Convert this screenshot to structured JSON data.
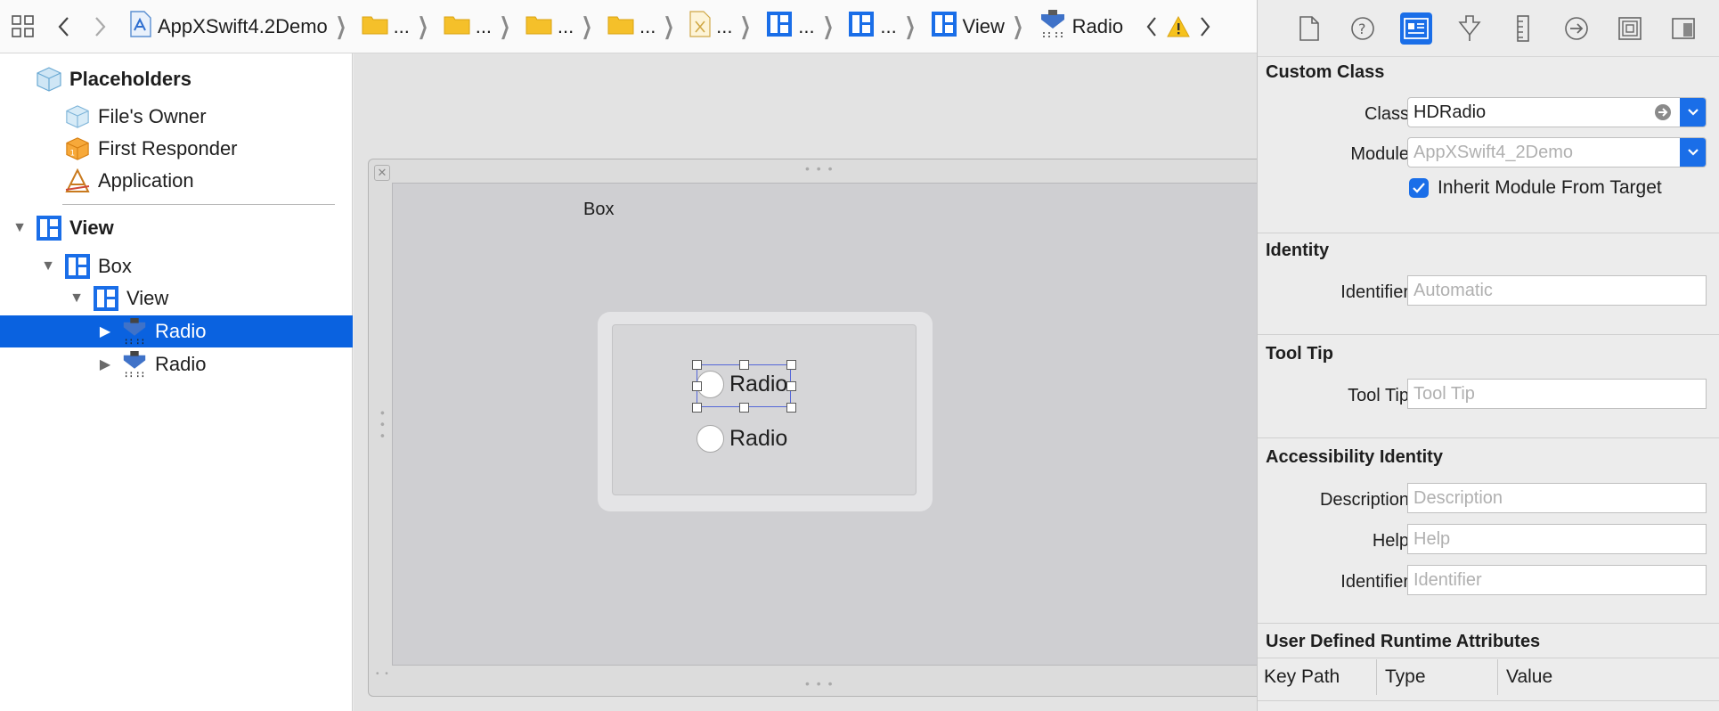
{
  "jumpbar": {
    "crumbs": [
      {
        "label": "AppXSwift4.2Demo",
        "icon": "swift-project-icon"
      },
      {
        "label": "...",
        "icon": "folder-icon"
      },
      {
        "label": "...",
        "icon": "folder-icon"
      },
      {
        "label": "...",
        "icon": "folder-icon"
      },
      {
        "label": "...",
        "icon": "folder-icon"
      },
      {
        "label": "...",
        "icon": "xib-file-icon"
      },
      {
        "label": "...",
        "icon": "view-icon"
      },
      {
        "label": "...",
        "icon": "view-icon"
      },
      {
        "label": "View",
        "icon": "view-icon"
      },
      {
        "label": "Radio",
        "icon": "radio-icon"
      }
    ]
  },
  "outline": {
    "placeholders": "Placeholders",
    "files_owner": "File's Owner",
    "first_responder": "First Responder",
    "application": "Application",
    "view": "View",
    "box": "Box",
    "inner_view": "View",
    "radio1": "Radio",
    "radio2": "Radio"
  },
  "canvas": {
    "box_title": "Box",
    "radio1": "Radio",
    "radio2": "Radio"
  },
  "inspector": {
    "custom_class": {
      "title": "Custom Class",
      "class_label": "Class",
      "class_value": "HDRadio",
      "module_label": "Module",
      "module_placeholder": "AppXSwift4_2Demo",
      "inherit_label": "Inherit Module From Target"
    },
    "identity": {
      "title": "Identity",
      "identifier_label": "Identifier",
      "identifier_placeholder": "Automatic"
    },
    "tooltip": {
      "title": "Tool Tip",
      "label": "Tool Tip",
      "placeholder": "Tool Tip"
    },
    "accessibility": {
      "title": "Accessibility Identity",
      "description_label": "Description",
      "description_placeholder": "Description",
      "help_label": "Help",
      "help_placeholder": "Help",
      "identifier_label": "Identifier",
      "identifier_placeholder": "Identifier"
    },
    "runtime": {
      "title": "User Defined Runtime Attributes",
      "col_keypath": "Key Path",
      "col_type": "Type",
      "col_value": "Value"
    }
  },
  "colors": {
    "selection": "#0a62e0",
    "accent": "#1a6ee8",
    "folder": "#f5c02a"
  }
}
